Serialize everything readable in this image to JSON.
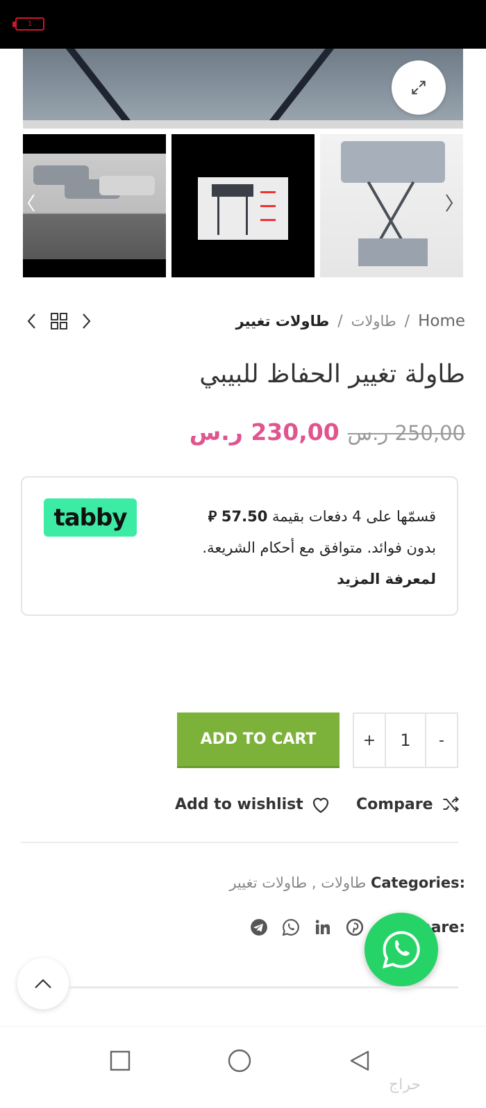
{
  "status_bar": {
    "battery_level": "1"
  },
  "breadcrumb": {
    "home": "Home",
    "separator": "/",
    "category": "طاولات",
    "current": "طاولات تغيير"
  },
  "product": {
    "title": "طاولة تغيير الحفاظ للبيبي",
    "price_old": "250,00 ر.س",
    "price_new": "230,00 ر.س"
  },
  "tabby": {
    "logo": "tabby",
    "line1_prefix": "قسمّها على 4 دفعات بقيمة",
    "amount": "57.50",
    "currency_symbol": "⃁",
    "line2": "بدون فوائد. متوافق مع أحكام الشريعة.",
    "learn_more": "لمعرفة المزيد"
  },
  "cart": {
    "plus": "+",
    "quantity": "1",
    "minus": "-",
    "add_to_cart": "ADD TO CART"
  },
  "actions": {
    "wishlist": "Add to wishlist",
    "compare": "Compare"
  },
  "meta": {
    "categories_label": "Categories:",
    "categories_value": "طاولات , طاولات تغيير",
    "share_label": "Share:"
  },
  "colors": {
    "price_accent": "#e0548f",
    "cart_button": "#7db23a",
    "tabby_green": "#3deca4",
    "whatsapp": "#25d366"
  },
  "watermark": "حراج"
}
